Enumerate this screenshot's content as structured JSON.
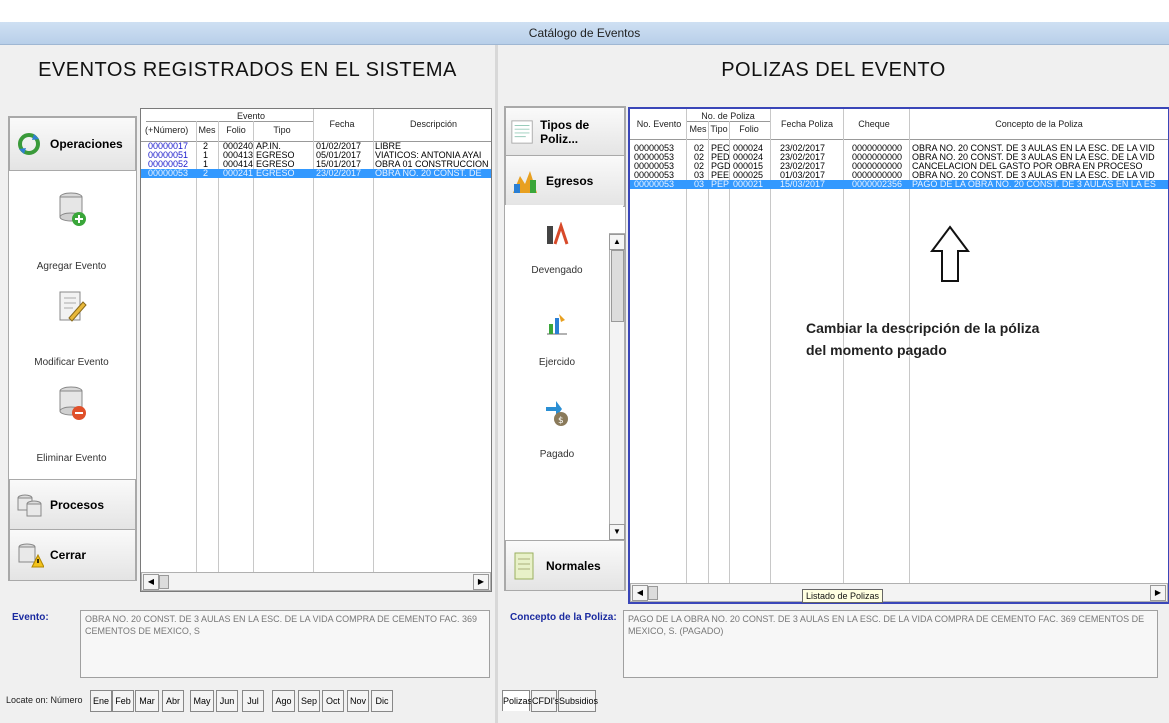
{
  "window": {
    "title": "Catálogo de Eventos"
  },
  "left": {
    "heading": "EVENTOS REGISTRADOS EN EL SISTEMA",
    "operaciones": "Operaciones",
    "actions": [
      {
        "label": "Agregar Evento",
        "icon": "database-add-icon"
      },
      {
        "label": "Modificar Evento",
        "icon": "edit-document-icon"
      },
      {
        "label": "Eliminar Evento",
        "icon": "database-remove-icon"
      }
    ],
    "procesos": "Procesos",
    "cerrar": "Cerrar",
    "grid": {
      "group_header": "Evento",
      "columns": [
        "(+Número)",
        "Mes",
        "Folio",
        "Tipo",
        "Fecha",
        "Descripción"
      ],
      "rows": [
        {
          "numero": "00000017",
          "mes": "2",
          "folio": "000240",
          "tipo": "AP.IN.",
          "fecha": "01/02/2017",
          "desc": "LIBRE"
        },
        {
          "numero": "00000051",
          "mes": "1",
          "folio": "000413",
          "tipo": "EGRESO",
          "fecha": "05/01/2017",
          "desc": "VIATICOS: ANTONIA AYAI"
        },
        {
          "numero": "00000052",
          "mes": "1",
          "folio": "000414",
          "tipo": "EGRESO",
          "fecha": "15/01/2017",
          "desc": "OBRA 01 CONSTRUCCION"
        },
        {
          "numero": "00000053",
          "mes": "2",
          "folio": "000241",
          "tipo": "EGRESO",
          "fecha": "23/02/2017",
          "desc": "OBRA NO. 20 CONST. DE"
        }
      ]
    },
    "evento_label": "Evento:",
    "evento_text": "OBRA NO. 20 CONST. DE 3 AULAS EN LA ESC. DE LA VIDA COMPRA DE CEMENTO FAC. 369 CEMENTOS DE MEXICO, S",
    "locate_label": "Locate on: Número",
    "month_tabs": [
      "Ene",
      "Feb",
      "Mar",
      "Abr",
      "May",
      "Jun",
      "Jul",
      "Ago",
      "Sep",
      "Oct",
      "Nov",
      "Dic"
    ]
  },
  "right": {
    "heading": "POLIZAS DEL EVENTO",
    "tipos": "Tipos de Poliz...",
    "egresos": "Egresos",
    "moments": [
      {
        "label": "Devengado",
        "icon": "devengado-icon"
      },
      {
        "label": "Ejercido",
        "icon": "ejercido-icon"
      },
      {
        "label": "Pagado",
        "icon": "pagado-icon"
      }
    ],
    "normales": "Normales",
    "grid": {
      "group_header": "No. de Poliza",
      "columns": [
        "No. Evento",
        "Mes",
        "Tipo",
        "Folio",
        "Fecha Poliza",
        "Cheque",
        "Concepto de la Poliza"
      ],
      "rows": [
        {
          "evento": "00000053",
          "mes": "02",
          "tipo": "PEC",
          "folio": "000024",
          "fecha": "23/02/2017",
          "cheque": "0000000000",
          "concepto": "OBRA NO. 20 CONST. DE 3 AULAS EN LA ESC. DE LA VID"
        },
        {
          "evento": "00000053",
          "mes": "02",
          "tipo": "PED",
          "folio": "000024",
          "fecha": "23/02/2017",
          "cheque": "0000000000",
          "concepto": "OBRA NO. 20 CONST. DE 3 AULAS EN LA ESC. DE LA VID"
        },
        {
          "evento": "00000053",
          "mes": "02",
          "tipo": "PGD",
          "folio": "000015",
          "fecha": "23/02/2017",
          "cheque": "0000000000",
          "concepto": "CANCELACION DEL GASTO POR OBRA EN PROCESO"
        },
        {
          "evento": "00000053",
          "mes": "03",
          "tipo": "PEE",
          "folio": "000025",
          "fecha": "01/03/2017",
          "cheque": "0000000000",
          "concepto": "OBRA NO. 20 CONST. DE 3 AULAS EN LA ESC. DE LA VID"
        },
        {
          "evento": "00000053",
          "mes": "03",
          "tipo": "PEP",
          "folio": "000021",
          "fecha": "15/03/2017",
          "cheque": "0000002356",
          "concepto": "PAGO DE LA OBRA NO. 20 CONST. DE 3 AULAS EN LA ES"
        }
      ]
    },
    "annotation_line1": "Cambiar la descripción de la póliza",
    "annotation_line2": "del momento pagado",
    "tooltip": "Listado de Polizas",
    "concepto_label": "Concepto de la Poliza:",
    "concepto_text": "PAGO DE LA OBRA NO. 20 CONST. DE 3 AULAS EN LA ESC. DE LA VIDA COMPRA DE CEMENTO FAC. 369 CEMENTOS DE MEXICO, S. (PAGADO)",
    "bottom_tabs": [
      "Polizas",
      "CFDI's",
      "Subsidios"
    ]
  },
  "colors": {
    "selection": "#3399ff",
    "link_blue": "#1a1acc",
    "label_blue": "#1a2aa0"
  }
}
